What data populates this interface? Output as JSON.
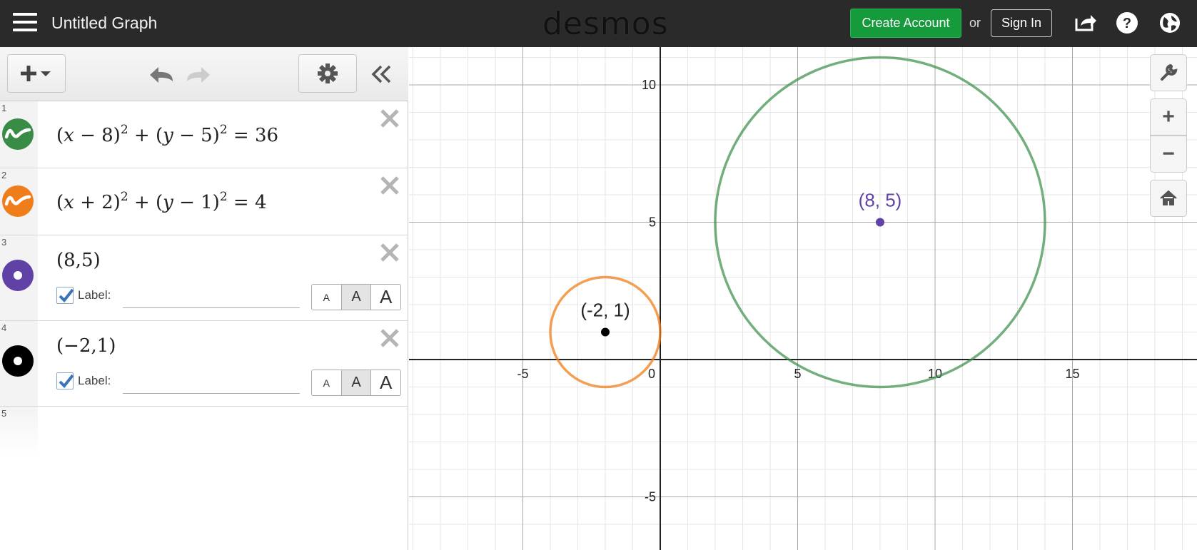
{
  "header": {
    "title": "Untitled Graph",
    "logo": "desmos",
    "create_account": "Create Account",
    "or": "or",
    "sign_in": "Sign In",
    "icons": [
      "menu-icon",
      "share-icon",
      "help-icon",
      "globe-icon"
    ]
  },
  "toolbar": {
    "add_label": "+",
    "icons": [
      "add-expression-icon",
      "undo-icon",
      "redo-icon",
      "gear-icon",
      "collapse-icon"
    ]
  },
  "expressions": [
    {
      "index": "1",
      "color": "#388c46",
      "parts": [
        "(",
        "x",
        " − 8)",
        "2",
        " + (",
        "y",
        " − 5)",
        "2",
        " = 36"
      ]
    },
    {
      "index": "2",
      "color": "#f07d1b",
      "parts": [
        "(",
        "x",
        " + 2)",
        "2",
        " + (",
        "y",
        " − 1)",
        "2",
        " = 4"
      ]
    },
    {
      "index": "3",
      "color": "#6042a6",
      "text": "(8,5)",
      "label_text": "Label:",
      "checked": true
    },
    {
      "index": "4",
      "color": "#000000",
      "text": "(−2,1)",
      "label_text": "Label:",
      "checked": true
    },
    {
      "index": "5"
    }
  ],
  "size_buttons": [
    "A",
    "A",
    "A"
  ],
  "graph": {
    "x_ticks": [
      "-5",
      "0",
      "5",
      "10",
      "15"
    ],
    "y_ticks": [
      "10",
      "5",
      "-5"
    ],
    "circle1": {
      "cx": 8,
      "cy": 5,
      "r": 6,
      "color": "#388c46"
    },
    "circle2": {
      "cx": -2,
      "cy": 1,
      "r": 2,
      "color": "#f07d1b"
    },
    "point1": {
      "x": 8,
      "y": 5,
      "label": "(8, 5)",
      "color": "#6042a6"
    },
    "point2": {
      "x": -2,
      "y": 1,
      "label": "(-2, 1)",
      "color": "#000000"
    }
  },
  "graph_controls": {
    "zoom_in": "+",
    "zoom_out": "−",
    "icons": [
      "wrench-icon",
      "home-icon"
    ]
  }
}
